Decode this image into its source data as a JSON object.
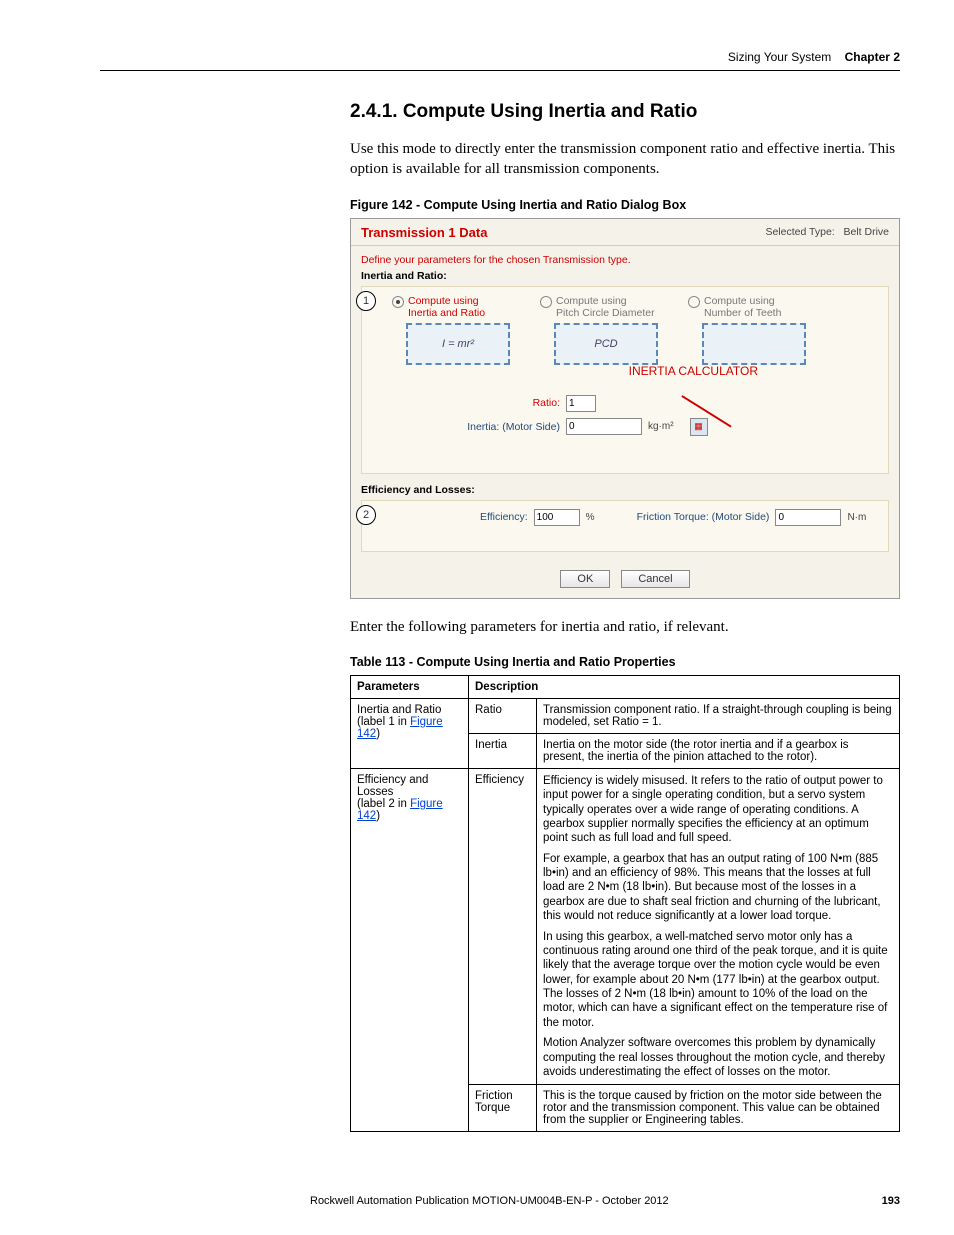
{
  "header": {
    "section": "Sizing Your System",
    "chapter": "Chapter 2"
  },
  "h2": "2.4.1.   Compute Using Inertia and Ratio",
  "intro": "Use this mode to directly enter the transmission component ratio and effective inertia. This option is available for all transmission components.",
  "figcap": "Figure 142 - Compute Using Inertia and Ratio Dialog Box",
  "dialog": {
    "title": "Transmission 1 Data",
    "selected_label": "Selected Type:",
    "selected_value": "Belt Drive",
    "instruction": "Define your parameters for the chosen Transmission type.",
    "section1": "Inertia and Ratio:",
    "modes": {
      "m1": "Compute using\nInertia and Ratio",
      "m1_formula": "I = mr²",
      "m2": "Compute using\nPitch Circle Diameter",
      "m2_sub": "PCD",
      "m3": "Compute using\nNumber of Teeth"
    },
    "ratio_label": "Ratio:",
    "ratio_val": "1",
    "inertia_label": "Inertia: (Motor Side)",
    "inertia_val": "0",
    "inertia_unit": "kg·m²",
    "annot": "INERTIA\nCALCULATOR",
    "section2": "Efficiency and Losses:",
    "eff_label": "Efficiency:",
    "eff_val": "100",
    "eff_unit": "%",
    "fric_label": "Friction Torque: (Motor Side)",
    "fric_val": "0",
    "fric_unit": "N·m",
    "ok": "OK",
    "cancel": "Cancel",
    "c1": "1",
    "c2": "2"
  },
  "post": "Enter the following parameters for inertia and ratio, if relevant.",
  "tabcap": "Table 113 - Compute Using Inertia and Ratio Properties",
  "table": {
    "h1": "Parameters",
    "h2": "Description",
    "r1_param": "Inertia and Ratio",
    "r1_sub_a": "(label 1 in ",
    "r1_sub_link": "Figure 142",
    "r1_sub_b": ")",
    "r1a_name": "Ratio",
    "r1a_desc": "Transmission component ratio. If a straight-through coupling is being modeled, set Ratio = 1.",
    "r1b_name": "Inertia",
    "r1b_desc": "Inertia on the motor side (the rotor inertia and if a gearbox is present, the inertia of the pinion attached to the rotor).",
    "r2_param": "Efficiency and Losses",
    "r2_sub_a": "(label 2 in ",
    "r2_sub_link": "Figure 142",
    "r2_sub_b": ")",
    "r2a_name": "Efficiency",
    "r2a_p1": "Efficiency is widely misused. It refers to the ratio of output power to input power for a single operating condition, but a servo system typically operates over a wide range of operating conditions. A gearbox supplier normally specifies the efficiency at an optimum point such as full load and full speed.",
    "r2a_p2": "For example, a gearbox that has an output rating of 100 N•m (885 lb•in) and an efficiency of 98%. This means that the losses at full load are 2 N•m (18 lb•in). But because most of the losses in a gearbox are due to shaft seal friction and churning of the lubricant, this would not reduce significantly at a lower load torque.",
    "r2a_p3": "In using this gearbox, a well-matched servo motor only has a continuous rating around one third of the peak torque, and it is quite likely that the average torque over the motion cycle would be even lower, for example about 20 N•m (177 lb•in) at the gearbox output. The losses of 2 N•m (18 lb•in) amount to 10% of the load on the motor, which can have a significant effect on the temperature rise of the motor.",
    "r2a_p4": "Motion Analyzer software overcomes this problem by dynamically computing the real losses throughout the motion cycle, and thereby avoids underestimating the effect of losses on the motor.",
    "r2b_name": "Friction Torque",
    "r2b_desc": "This is the torque caused by friction on the motor side between the rotor and the transmission component. This value can be obtained from the supplier or Engineering tables."
  },
  "footer": {
    "pub": "Rockwell Automation Publication MOTION-UM004B-EN-P - October 2012",
    "page": "193"
  }
}
